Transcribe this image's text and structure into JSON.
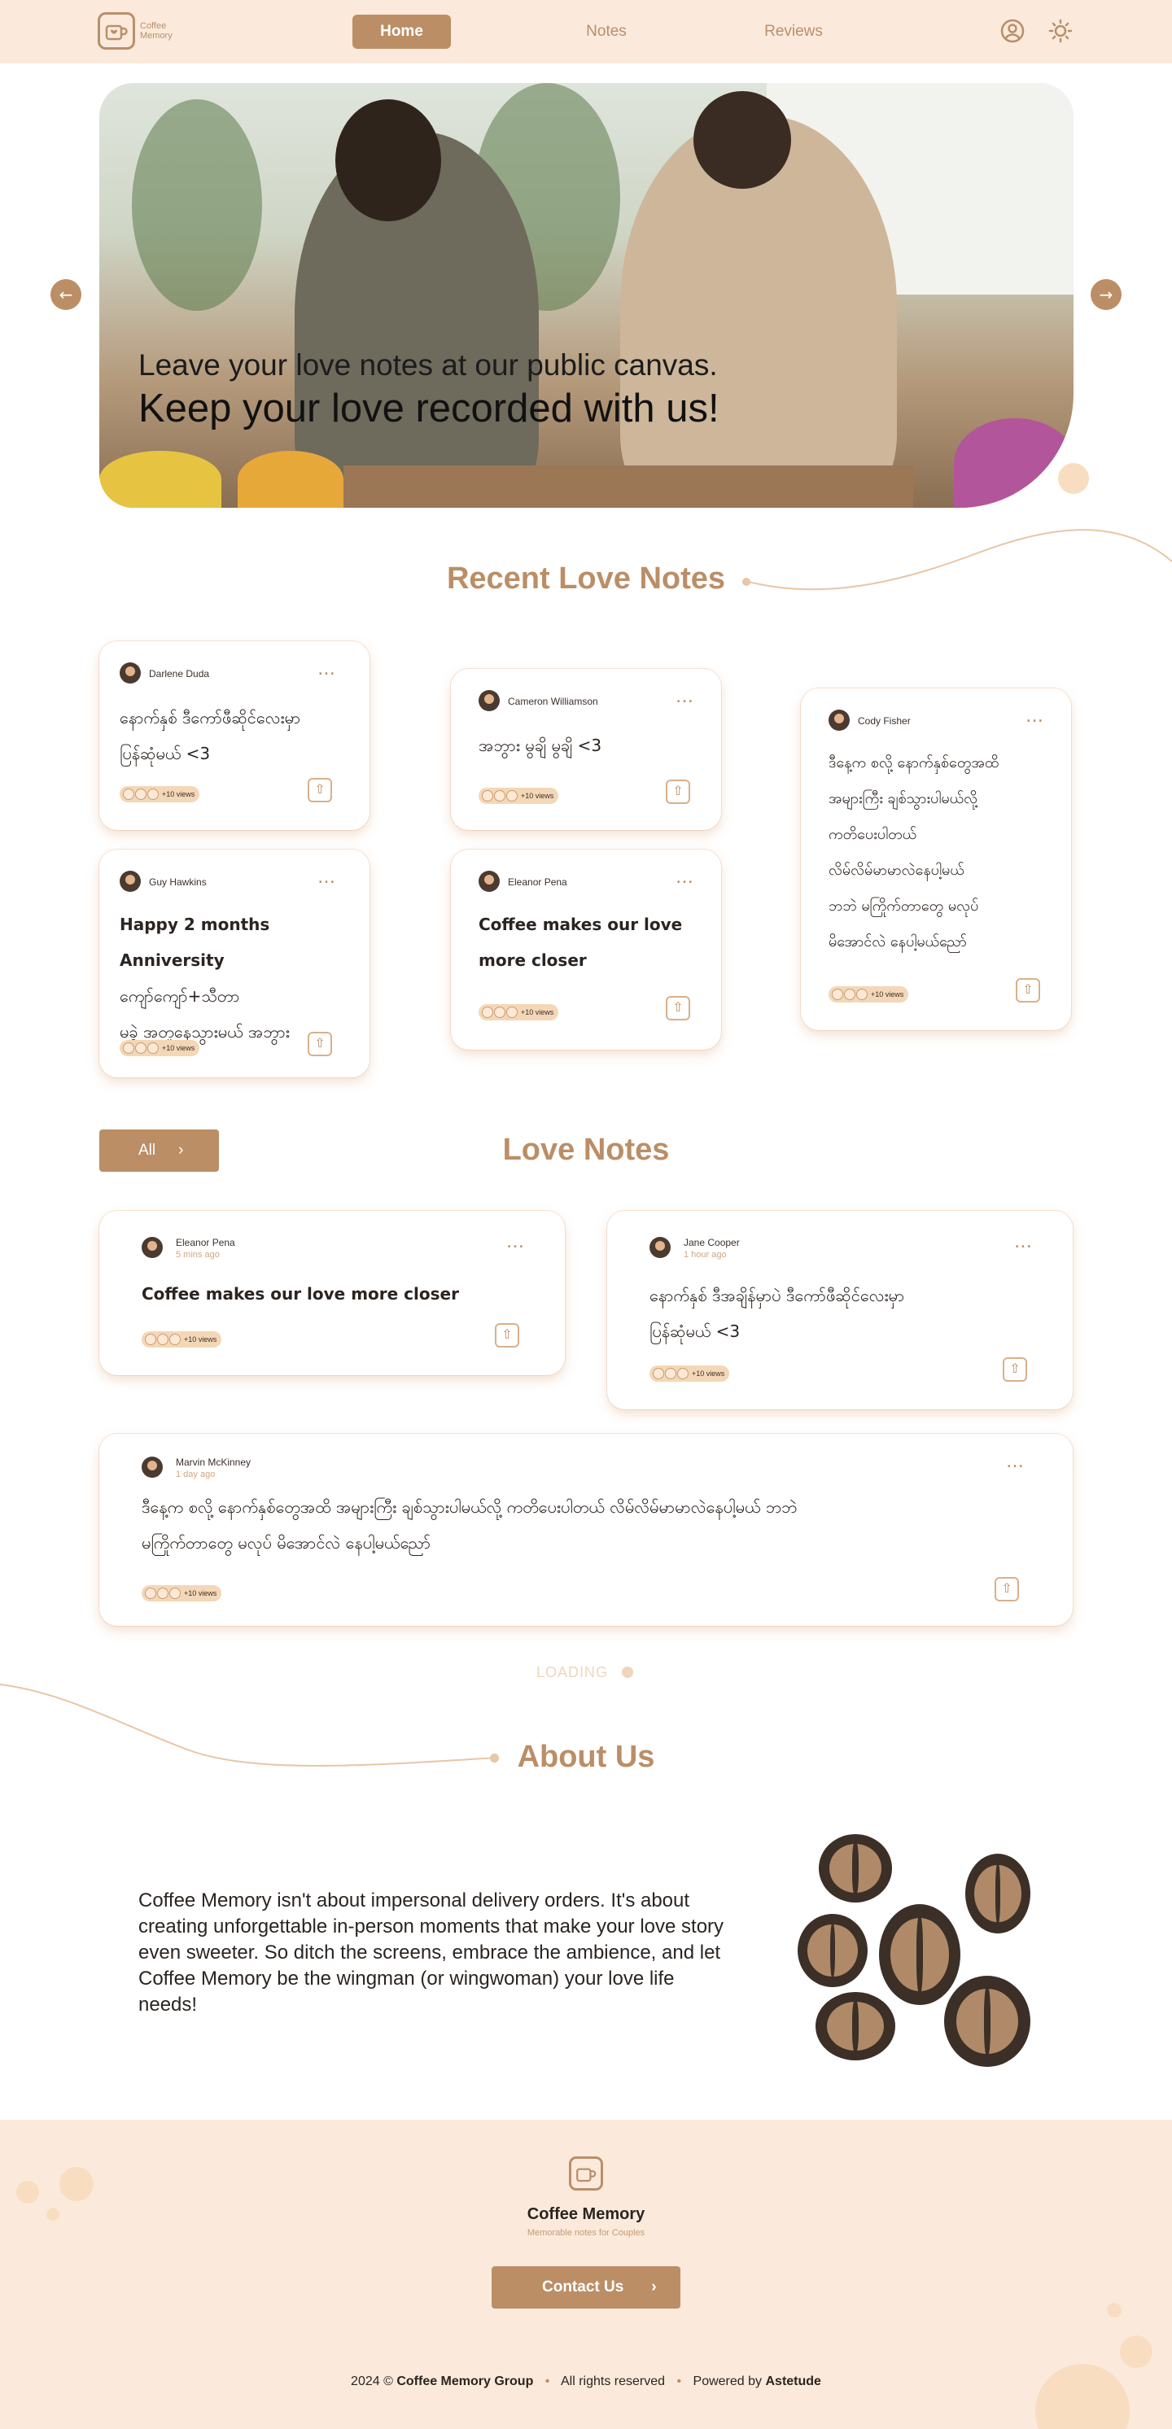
{
  "header": {
    "logo_text_line1": "Coffee",
    "logo_text_line2": "Memory",
    "nav": [
      "Home",
      "Notes",
      "Reviews"
    ],
    "active_nav": "Home"
  },
  "hero": {
    "line1": "Leave your love notes at our public canvas.",
    "line2": "Keep your love recorded with us!"
  },
  "recent": {
    "title": "Recent Love Notes",
    "cards": [
      {
        "author": "Darlene Duda",
        "lines": [
          "နောက်နှစ် ဒီကော်ဖီဆိုင်လေးမှာ",
          "ပြန်ဆုံမယ် <3"
        ],
        "views": "+10 views"
      },
      {
        "author": "Guy Hawkins",
        "lines": [
          "Happy 2 months Anniversity",
          "ကျော်ကျော်+သီတာ",
          "မခွဲ အတူနေသွားမယ် အဘွား"
        ],
        "views": "+10 views"
      },
      {
        "author": "Cameron Williamson",
        "lines": [
          "အဘွား မွချိ မွချိ <3"
        ],
        "views": "+10 views"
      },
      {
        "author": "Eleanor Pena",
        "lines": [
          "Coffee makes our love",
          "more closer"
        ],
        "views": "+10 views"
      },
      {
        "author": "Cody Fisher",
        "lines": [
          "ဒီနေ့က စလို့ နောက်နှစ်တွေအထိ",
          "အများကြီး ချစ်သွားပါမယ်လို့",
          "ကတိပေးပါတယ်",
          "လိမ်လိမ်မာမာလဲနေပါ့မယ်",
          "ဘဘဲ မကြိုက်တာတွေ မလုပ်",
          "မိအောင်လဲ နေပါ့မယ်ညော်"
        ],
        "views": "+10 views"
      }
    ]
  },
  "notes": {
    "title": "Love Notes",
    "filter_label": "All",
    "cards": [
      {
        "author": "Eleanor Pena",
        "time": "5 mins ago",
        "text": "Coffee makes our love more closer",
        "views": "+10 views"
      },
      {
        "author": "Jane Cooper",
        "time": "1 hour ago",
        "lines": [
          "နောက်နှစ် ဒီအချိန်မှာပဲ ဒီကော်ဖီဆိုင်လေးမှာ",
          "ပြန်ဆုံမယ် <3"
        ],
        "views": "+10 views"
      },
      {
        "author": "Marvin McKinney",
        "time": "1 day ago",
        "lines": [
          "ဒီနေ့က စလို့ နောက်နှစ်တွေအထိ အများကြီး ချစ်သွားပါမယ်လို့ ကတိပေးပါတယ် လိမ်လိမ်မာမာလဲနေပါ့မယ် ဘဘဲ",
          "မကြိုက်တာတွေ မလုပ် မိအောင်လဲ နေပါ့မယ်ညော်"
        ],
        "views": "+10 views"
      }
    ],
    "loading": "LOADING"
  },
  "about": {
    "title": "About Us",
    "text": "Coffee Memory isn't about impersonal delivery orders. It's about creating unforgettable in-person moments that make your love story even sweeter. So ditch the screens, embrace the ambience, and let Coffee Memory be the wingman (or wingwoman) your love life needs!"
  },
  "footer": {
    "name": "Coffee Memory",
    "tagline": "Memorable notes for Couples",
    "contact": "Contact Us",
    "year": "2024 ©",
    "group": "Coffee Memory Group",
    "rights": "All rights reserved",
    "powered": "Powered by",
    "powered_by": "Astetude"
  },
  "colors": {
    "accent": "#bb8e66",
    "header_bg": "#fbeadb",
    "text": "#2b2420"
  },
  "icons": [
    "coffee-cup-icon",
    "user-icon",
    "sun-icon",
    "arrow-left-icon",
    "arrow-right-icon",
    "share-icon",
    "more-icon",
    "chevron-right-icon"
  ]
}
